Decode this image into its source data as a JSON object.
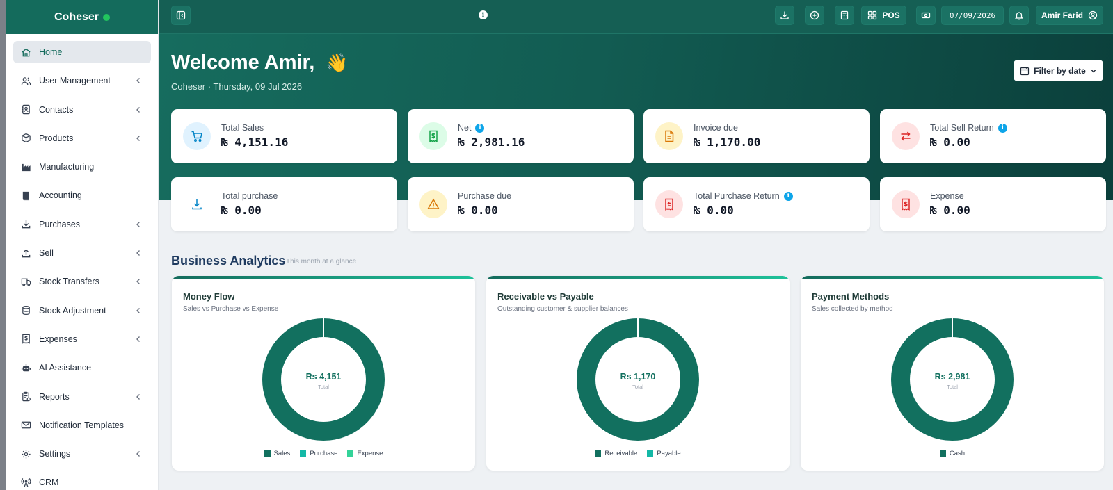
{
  "sidebar": {
    "brand": "Coheser",
    "items": [
      {
        "label": "Home",
        "icon": "home-icon",
        "active": true,
        "chevron": false
      },
      {
        "label": "User Management",
        "icon": "users-icon",
        "chevron": true
      },
      {
        "label": "Contacts",
        "icon": "contacts-icon",
        "chevron": true
      },
      {
        "label": "Products",
        "icon": "box-icon",
        "chevron": true
      },
      {
        "label": "Manufacturing",
        "icon": "factory-icon",
        "chevron": false
      },
      {
        "label": "Accounting",
        "icon": "book-icon",
        "chevron": false
      },
      {
        "label": "Purchases",
        "icon": "download-icon",
        "chevron": true
      },
      {
        "label": "Sell",
        "icon": "upload-icon",
        "chevron": true
      },
      {
        "label": "Stock Transfers",
        "icon": "truck-icon",
        "chevron": true
      },
      {
        "label": "Stock Adjustment",
        "icon": "database-icon",
        "chevron": true
      },
      {
        "label": "Expenses",
        "icon": "receipt-icon",
        "chevron": true
      },
      {
        "label": "AI Assistance",
        "icon": "robot-icon",
        "chevron": false
      },
      {
        "label": "Reports",
        "icon": "clipboard-icon",
        "chevron": true
      },
      {
        "label": "Notification Templates",
        "icon": "envelope-icon",
        "chevron": false
      },
      {
        "label": "Settings",
        "icon": "gear-icon",
        "chevron": true
      },
      {
        "label": "CRM",
        "icon": "broadcast-icon",
        "chevron": false
      }
    ]
  },
  "topbar": {
    "pos_label": "POS",
    "date": "07/09/2026",
    "user": "Amir Farid"
  },
  "hero": {
    "welcome": "Welcome Amir,",
    "wave": "👋",
    "subtitle": "Coheser · Thursday, 09 Jul 2026",
    "filter_label": "Filter by date"
  },
  "stats": [
    {
      "label": "Total Sales",
      "value": "₨ 4,151.16",
      "icon": "cart-icon",
      "info": false
    },
    {
      "label": "Net",
      "value": "₨ 2,981.16",
      "icon": "money-receipt-icon",
      "info": true
    },
    {
      "label": "Invoice due",
      "value": "₨ 1,170.00",
      "icon": "file-icon",
      "info": false
    },
    {
      "label": "Total Sell Return",
      "value": "₨ 0.00",
      "icon": "exchange-icon",
      "info": true
    },
    {
      "label": "Total purchase",
      "value": "₨ 0.00",
      "icon": "download-icon",
      "info": false
    },
    {
      "label": "Purchase due",
      "value": "₨ 0.00",
      "icon": "warning-icon",
      "info": false
    },
    {
      "label": "Total Purchase Return",
      "value": "₨ 0.00",
      "icon": "receipt-return-icon",
      "info": true
    },
    {
      "label": "Expense",
      "value": "₨ 0.00",
      "icon": "expense-receipt-icon",
      "info": false
    }
  ],
  "analytics": {
    "title": "Business Analytics",
    "subtitle": "This month at a glance"
  },
  "panels": [
    {
      "title": "Money Flow",
      "subtitle": "Sales vs Purchase vs Expense",
      "center_value": "Rs 4,151",
      "center_label": "Total",
      "legend": [
        {
          "name": "Sales",
          "color": "#12705f"
        },
        {
          "name": "Purchase",
          "color": "#14b8a6"
        },
        {
          "name": "Expense",
          "color": "#34d399"
        }
      ]
    },
    {
      "title": "Receivable vs Payable",
      "subtitle": "Outstanding customer & supplier balances",
      "center_value": "Rs 1,170",
      "center_label": "Total",
      "legend": [
        {
          "name": "Receivable",
          "color": "#12705f"
        },
        {
          "name": "Payable",
          "color": "#14b8a6"
        }
      ]
    },
    {
      "title": "Payment Methods",
      "subtitle": "Sales collected by method",
      "center_value": "Rs 2,981",
      "center_label": "Total",
      "legend": [
        {
          "name": "Cash",
          "color": "#12705f"
        }
      ]
    }
  ],
  "chart_data": [
    {
      "type": "pie",
      "title": "Money Flow",
      "categories": [
        "Sales",
        "Purchase",
        "Expense"
      ],
      "values": [
        4151.16,
        0,
        0
      ]
    },
    {
      "type": "pie",
      "title": "Receivable vs Payable",
      "categories": [
        "Receivable",
        "Payable"
      ],
      "values": [
        1170,
        0
      ]
    },
    {
      "type": "pie",
      "title": "Payment Methods",
      "categories": [
        "Cash"
      ],
      "values": [
        2981.16
      ]
    }
  ],
  "colors": {
    "brand": "#146b5c",
    "donut": "#12705f"
  }
}
